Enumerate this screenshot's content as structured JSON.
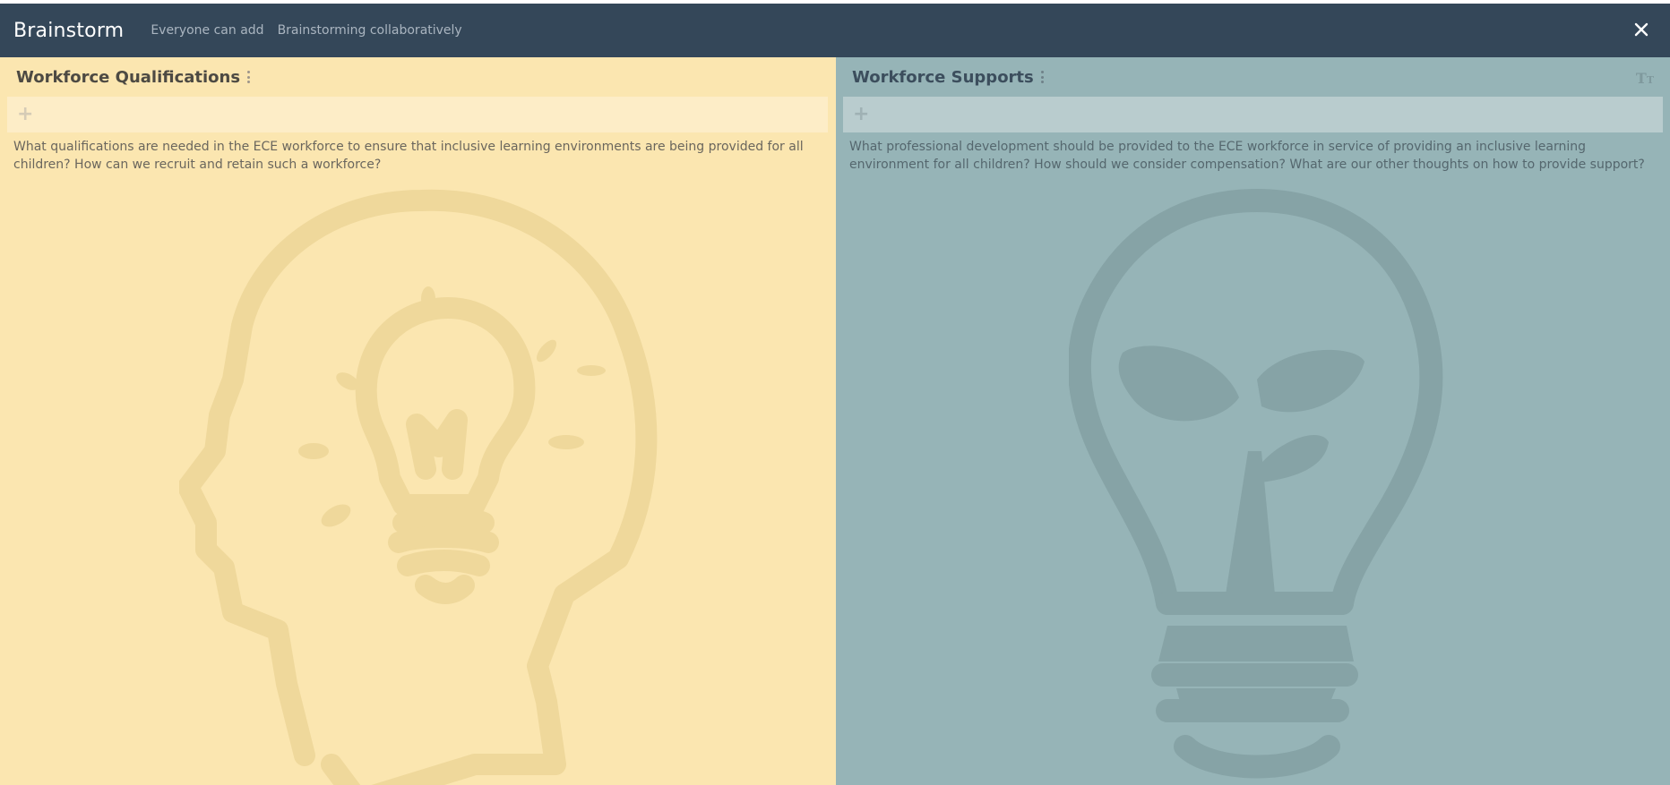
{
  "app": {
    "title": "Brainstorm",
    "meta_permission": "Everyone can add",
    "meta_mode": "Brainstorming collaboratively",
    "close_icon": "close-icon"
  },
  "columns": [
    {
      "title": "Workforce Qualifications",
      "prompt": "What qualifications are needed in the ECE workforce to ensure that inclusive learning environments are being provided for all children? How can we recruit and retain such a workforce?",
      "background_color": "#fbe6b0",
      "illustration": "head-with-lightbulb-icon"
    },
    {
      "title": "Workforce Supports",
      "prompt": "What professional development should be provided to the ECE workforce in service of providing an inclusive learning environment for all children? How should we consider compensation? What are our other thoughts on how to provide support?",
      "background_color": "#96b4b7",
      "illustration": "lightbulb-with-sprout-icon"
    }
  ],
  "colors": {
    "topbar": "#344759",
    "left_column": "#fbe6b0",
    "right_column": "#96b4b7"
  }
}
